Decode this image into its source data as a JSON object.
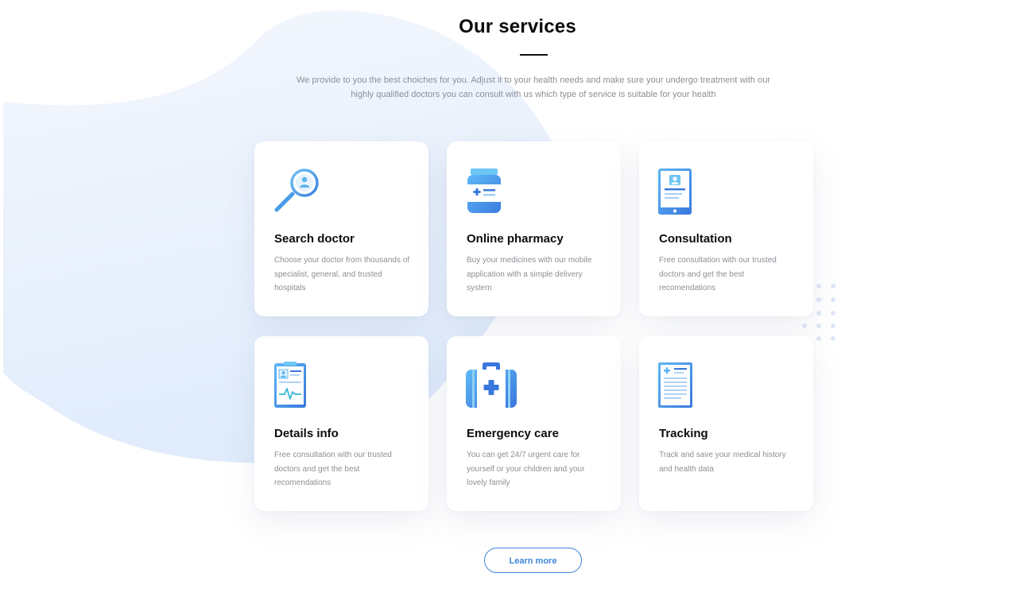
{
  "section": {
    "title": "Our services",
    "subtitle_line1": "We provide to you the best choiches for you. Adjust it to your health needs and make sure your undergo treatment with our",
    "subtitle_line2": "highly qualified doctors you can consult with us which type of service is suitable for your health"
  },
  "services": [
    {
      "title": "Search doctor",
      "icon": "magnifier-doctor-icon",
      "desc_lines": [
        "Choose your doctor from thousands of",
        "specialist, general, and trusted hospitals"
      ]
    },
    {
      "title": "Online pharmacy",
      "icon": "medicine-bottle-icon",
      "desc_lines": [
        "Buy your medicines with our mobile",
        "application with a simple delivery",
        "system"
      ]
    },
    {
      "title": "Consultation",
      "icon": "tablet-profile-icon",
      "desc_lines": [
        "Free consultation with our trusted",
        "doctors and get the best",
        "recomendations"
      ]
    },
    {
      "title": "Details info",
      "icon": "clipboard-heartbeat-icon",
      "desc_lines": [
        "Free consultation with our trusted",
        "doctors and get the best",
        "recomendations"
      ]
    },
    {
      "title": "Emergency care",
      "icon": "first-aid-kit-icon",
      "desc_lines": [
        "You can get 24/7 urgent care for",
        "yourself or your children and your",
        "lovely family"
      ]
    },
    {
      "title": "Tracking",
      "icon": "medical-document-icon",
      "desc_lines": [
        "Track and save your medical history",
        "and health data"
      ]
    }
  ],
  "cta": {
    "label": "Learn more"
  },
  "colors": {
    "accent": "#3f86d9",
    "blob_start": "#f2f6fd",
    "blob_end": "#e2edfc",
    "dots": "#dfe7f6"
  }
}
